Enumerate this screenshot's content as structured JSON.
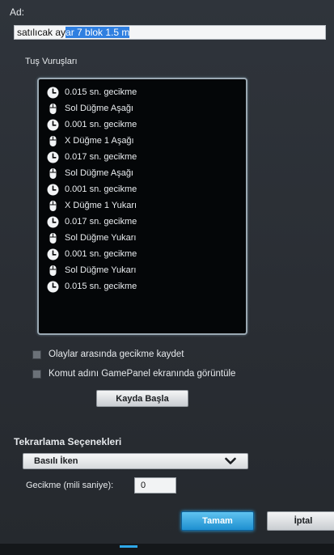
{
  "name_section": {
    "label": "Ad:",
    "value_plain": "satılıcak ay",
    "value_selected": "ar 7 blok 1.5 m"
  },
  "keystrokes": {
    "label": "Tuş Vuruşları",
    "items": [
      {
        "icon": "clock-icon",
        "text": "0.015 sn. gecikme"
      },
      {
        "icon": "mouse-icon",
        "text": "Sol Düğme Aşağı"
      },
      {
        "icon": "clock-icon",
        "text": "0.001 sn. gecikme"
      },
      {
        "icon": "mouse-icon",
        "text": "X Düğme 1 Aşağı"
      },
      {
        "icon": "clock-icon",
        "text": "0.017 sn. gecikme"
      },
      {
        "icon": "mouse-icon",
        "text": "Sol Düğme Aşağı"
      },
      {
        "icon": "clock-icon",
        "text": "0.001 sn. gecikme"
      },
      {
        "icon": "mouse-icon",
        "text": "X Düğme 1 Yukarı"
      },
      {
        "icon": "clock-icon",
        "text": "0.017 sn. gecikme"
      },
      {
        "icon": "mouse-icon",
        "text": "Sol Düğme Yukarı"
      },
      {
        "icon": "clock-icon",
        "text": "0.001 sn. gecikme"
      },
      {
        "icon": "mouse-icon",
        "text": "Sol Düğme Yukarı"
      },
      {
        "icon": "clock-icon",
        "text": "0.015 sn. gecikme"
      }
    ]
  },
  "options": {
    "record_delays_label": "Olaylar arasında gecikme kaydet",
    "record_delays_checked": false,
    "show_name_label": "Komut adını GamePanel ekranında görüntüle",
    "show_name_checked": false,
    "start_recording_label": "Kayda Başla"
  },
  "repeat": {
    "section_title": "Tekrarlama Seçenekleri",
    "mode_value": "Basılı İken",
    "delay_label": "Gecikme (mili saniye):",
    "delay_value": "0"
  },
  "footer": {
    "ok_label": "Tamam",
    "cancel_label": "İptal"
  },
  "colors": {
    "accent": "#2ea7e8",
    "selection": "#2f7fe0",
    "list_background": "#040608"
  }
}
